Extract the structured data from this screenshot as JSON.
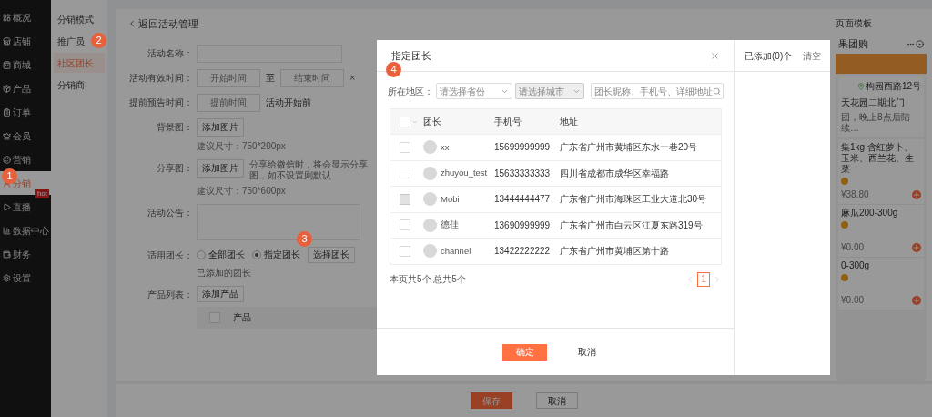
{
  "sidebar": {
    "items": [
      {
        "label": "概况",
        "selected": false
      },
      {
        "label": "店铺",
        "selected": false
      },
      {
        "label": "商城",
        "selected": false
      },
      {
        "label": "产品",
        "selected": false
      },
      {
        "label": "订单",
        "selected": false
      },
      {
        "label": "会员",
        "selected": false
      },
      {
        "label": "营销",
        "selected": false
      },
      {
        "label": "分销",
        "selected": true
      },
      {
        "label": "直播",
        "selected": false,
        "badge": "hot"
      },
      {
        "label": "数据中心",
        "selected": false
      },
      {
        "label": "财务",
        "selected": false
      },
      {
        "label": "设置",
        "selected": false
      }
    ]
  },
  "submenu": {
    "items": [
      {
        "label": "分销模式",
        "selected": false
      },
      {
        "label": "推广员",
        "selected": false
      },
      {
        "label": "社区团长",
        "selected": true
      },
      {
        "label": "分销商",
        "selected": false
      }
    ]
  },
  "page": {
    "back": "返回活动管理",
    "fields": [
      {
        "kind": "text",
        "label": "活动名称："
      },
      {
        "kind": "range",
        "label": "活动有效时间：",
        "start": "开始时间",
        "sep": "至",
        "end": "结束时间",
        "clear": "×"
      },
      {
        "kind": "time",
        "label": "提前预告时间：",
        "placeholder": "提前时间",
        "note": "活动开始前"
      },
      {
        "kind": "image",
        "label": "背景图：",
        "button": "添加图片",
        "hint": "建议尺寸：750*200px"
      },
      {
        "kind": "image",
        "label": "分享图：",
        "button": "添加图片",
        "desc": "分享给微信时，将会显示分享图，如不设置则默认",
        "hint": "建议尺寸：750*600px"
      },
      {
        "kind": "textarea",
        "label": "活动公告："
      },
      {
        "kind": "radio",
        "label": "适用团长：",
        "options": [
          {
            "label": "全部团长",
            "selected": false
          },
          {
            "label": "指定团长",
            "selected": true
          }
        ],
        "button": "选择团长",
        "note": "已添加的团长"
      },
      {
        "kind": "products",
        "label": "产品列表：",
        "button": "添加产品",
        "column": "产品",
        "checked": false
      }
    ],
    "save": "保存",
    "cancel": "取消"
  },
  "preview": {
    "tab": "页面模板",
    "title": "果团购",
    "address": "构园西路12号",
    "pickup": "天花园二期北门",
    "notice": "团，晚上8点后陆续…",
    "products": [
      {
        "name": "集1kg 含红萝卜、玉米、西兰花、生菜",
        "price": "¥38.80"
      },
      {
        "name": "麻瓜200-300g",
        "price": "¥0.00"
      },
      {
        "name": "0-300g",
        "price": "¥0.00"
      }
    ]
  },
  "modal": {
    "title": "指定团长",
    "filter_label": "所在地区：",
    "province": {
      "placeholder": "请选择省份",
      "disabled": false
    },
    "city": {
      "placeholder": "请选择城市",
      "disabled": true
    },
    "search": {
      "placeholder": "团长昵称、手机号、详细地址"
    },
    "select_all": {
      "checked": false
    },
    "columns": [
      "团长",
      "手机号",
      "地址"
    ],
    "rows": [
      {
        "name": "xx",
        "phone": "15699999999",
        "address": "广东省广州市黄埔区东水一巷20号",
        "checked": false,
        "disabled": false
      },
      {
        "name": "zhuyou_test",
        "phone": "15633333333",
        "address": "四川省成都市成华区幸福路",
        "checked": false,
        "disabled": false
      },
      {
        "name": "Mobi",
        "phone": "13444444477",
        "address": "广东省广州市海珠区工业大道北30号",
        "checked": false,
        "disabled": true
      },
      {
        "name": "德佳",
        "phone": "13690999999",
        "address": "广东省广州市白云区江夏东路319号",
        "checked": false,
        "disabled": false
      },
      {
        "name": "channel",
        "phone": "13422222222",
        "address": "广东省广州市黄埔区第十路",
        "checked": false,
        "disabled": false
      }
    ],
    "summary": "本页共5个 总共5个",
    "pages": [
      {
        "label": "1",
        "selected": true
      }
    ],
    "confirm": "确定",
    "cancel": "取消",
    "side": {
      "title": "已添加(0)个",
      "action": "清空"
    }
  },
  "annotations": [
    "1",
    "2",
    "3",
    "4"
  ]
}
